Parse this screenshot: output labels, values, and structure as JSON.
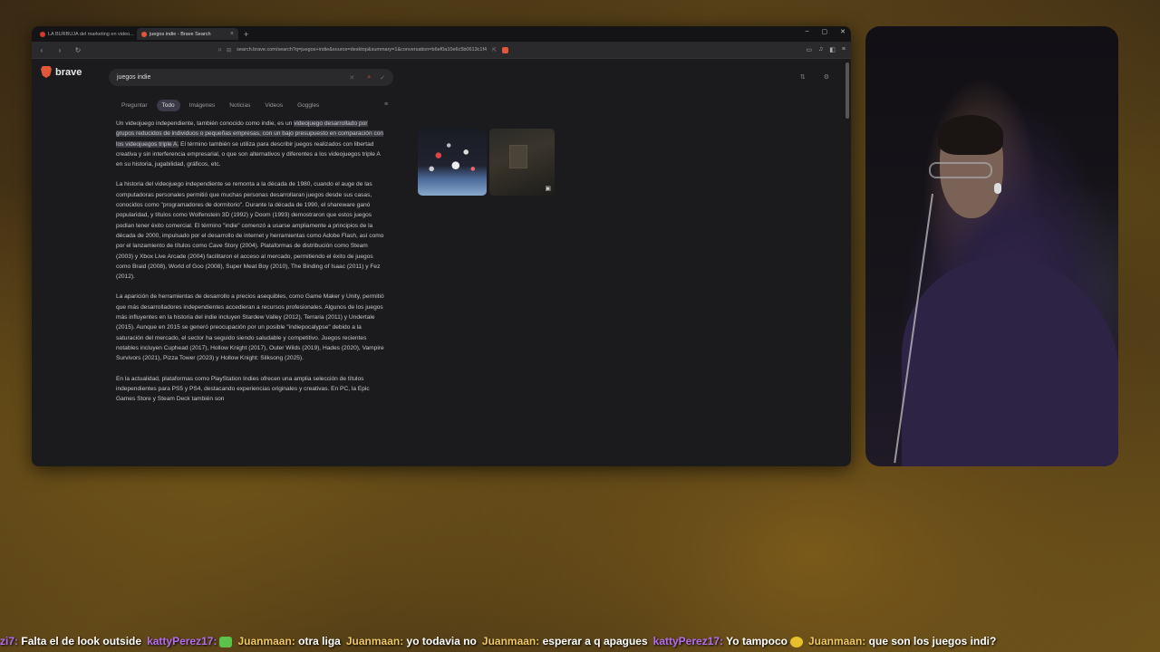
{
  "browser": {
    "tabs": [
      {
        "label": "LA BURBUJA del marketing en video...",
        "active": false,
        "favicon_color": "#d23a2a"
      },
      {
        "label": "juegos indie - Brave Search",
        "active": true,
        "favicon_color": "#e0573a"
      }
    ],
    "new_tab": "+",
    "window_controls": [
      "–",
      "▢",
      "✕"
    ],
    "url": "search.brave.com/search?q=juegos+indie&source=desktop&summary=1&conversation=b6ef0a10e6c5b0613c1f4"
  },
  "brave": {
    "logo_text": "brave",
    "search_query": "juegos indie",
    "nav_tabs": [
      "Preguntar",
      "Todo",
      "Imágenes",
      "Noticias",
      "Videos",
      "Goggles"
    ],
    "active_tab": "Todo"
  },
  "answer": {
    "p1_a": "Un videojuego independiente, también conocido como indie, es un ",
    "p1_hl": "videojuego desarrollado por grupos reducidos de individuos o pequeñas empresas, con un bajo presupuesto en comparación con los videojuegos triple A.",
    "p1_b": " El término también se utiliza para describir juegos realizados con libertad creativa y sin interferencia empresarial, o que son alternativos y diferentes a los videojuegos triple A en su historia, jugabilidad, gráficos, etc.",
    "p2": "La historia del videojuego independiente se remonta a la década de 1980, cuando el auge de las computadoras personales permitió que muchas personas desarrollaran juegos desde sus casas, conocidos como \"programadores de dormitorio\". Durante la década de 1990, el shareware ganó popularidad, y títulos como Wolfenstein 3D (1992) y Doom (1993) demostraron que estos juegos podían tener éxito comercial. El término \"indie\" comenzó a usarse ampliamente a principios de la década de 2000, impulsado por el desarrollo de internet y herramientas como Adobe Flash, así como por el lanzamiento de títulos como Cave Story (2004). Plataformas de distribución como Steam (2003) y Xbox Live Arcade (2004) facilitaron el acceso al mercado, permitiendo el éxito de juegos como Braid (2008), World of Goo (2008), Super Meat Boy (2010), The Binding of Isaac (2011) y Fez (2012).",
    "p3": "La aparición de herramientas de desarrollo a precios asequibles, como Game Maker y Unity, permitió que más desarrolladores independientes accedieran a recursos profesionales. Algunos de los juegos más influyentes en la historia del indie incluyen Stardew Valley (2012), Terraria (2011) y Undertale (2015). Aunque en 2015 se generó preocupación por un posible \"indiepocalypse\" debido a la saturación del mercado, el sector ha seguido siendo saludable y competitivo. Juegos recientes notables incluyen Cuphead (2017), Hollow Knight (2017), Outer Wilds (2019), Hades (2020), Vampire Survivors (2021), Pizza Tower (2023) y Hollow Knight: Silksong (2025).",
    "p4": "En la actualidad, plataformas como PlayStation Indies ofrecen una amplia selección de títulos independientes para PS5 y PS4, destacando experiencias originales y creativas. En PC, la Epic Games Store y Steam Deck también son"
  },
  "chat": [
    {
      "user": "",
      "text": "Falta el de look outside",
      "partial_user": "zi7:"
    },
    {
      "user": "kattyPerez17:",
      "text": "",
      "emote": "green"
    },
    {
      "user": "Juanmaan:",
      "text": "otra liga"
    },
    {
      "user": "Juanmaan:",
      "text": "yo todavia no"
    },
    {
      "user": "Juanmaan:",
      "text": "esperar a q apagues"
    },
    {
      "user": "kattyPerez17:",
      "text": "Yo tampoco",
      "emote": "yellow"
    },
    {
      "user": "Juanmaan:",
      "text": "que son los juegos indi?"
    }
  ]
}
